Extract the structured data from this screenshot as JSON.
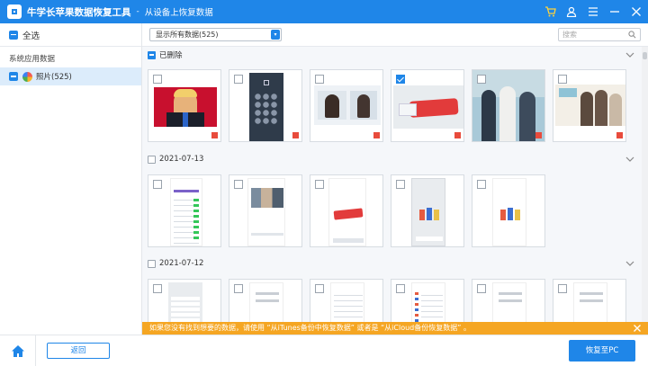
{
  "titlebar": {
    "app_title": "牛学长苹果数据恢复工具",
    "separator": "-",
    "subtitle": "从设备上恢复数据",
    "icons": [
      "cart-icon",
      "user-icon",
      "menu-icon",
      "minimize-icon",
      "close-icon"
    ]
  },
  "sidebar": {
    "select_all_label": "全选",
    "section_label": "系统应用数据",
    "items": [
      {
        "label": "照片(525)",
        "icon": "photos-icon"
      }
    ]
  },
  "header": {
    "filter_value": "显示所有数据(525)",
    "search_placeholder": "搜索"
  },
  "groups": [
    {
      "label": "已删除",
      "tiles": [
        {
          "checked": false,
          "deleted": true,
          "thumb": "photo-person-red-background"
        },
        {
          "checked": false,
          "deleted": true,
          "thumb": "screenshot-lock-screen-keypad"
        },
        {
          "checked": false,
          "deleted": true,
          "thumb": "photo-drama-stills"
        },
        {
          "checked": true,
          "deleted": true,
          "thumb": "photo-red-phone"
        },
        {
          "checked": false,
          "deleted": true,
          "thumb": "photo-group-outdoor"
        },
        {
          "checked": false,
          "deleted": true,
          "thumb": "photo-drama-poster"
        }
      ]
    },
    {
      "label": "2021-07-13",
      "tiles": [
        {
          "checked": false,
          "deleted": false,
          "thumb": "screenshot-settings-list"
        },
        {
          "checked": false,
          "deleted": false,
          "thumb": "screenshot-photo-album"
        },
        {
          "checked": false,
          "deleted": false,
          "thumb": "screenshot-red-phone-page"
        },
        {
          "checked": false,
          "deleted": false,
          "thumb": "screenshot-phones-page"
        },
        {
          "checked": false,
          "deleted": false,
          "thumb": "screenshot-phones-page-light"
        }
      ]
    },
    {
      "label": "2021-07-12",
      "tiles": [
        {
          "checked": false,
          "deleted": false,
          "thumb": "screenshot-settings-gray"
        },
        {
          "checked": false,
          "deleted": false,
          "thumb": "screenshot-settings-white"
        },
        {
          "checked": false,
          "deleted": false,
          "thumb": "screenshot-form-page"
        },
        {
          "checked": false,
          "deleted": false,
          "thumb": "screenshot-settings-color-list"
        },
        {
          "checked": false,
          "deleted": false,
          "thumb": "screenshot-settings-white-2"
        },
        {
          "checked": false,
          "deleted": false,
          "thumb": "screenshot-settings-white-3"
        }
      ]
    }
  ],
  "notice": {
    "text": "如果您没有找到想要的数据，请使用 “从iTunes备份中恢复数据” 或者是 “从iCloud备份恢复数据” 。"
  },
  "footer": {
    "back_label": "返回",
    "recover_label": "恢复至PC"
  },
  "colors": {
    "accent": "#1f86e8",
    "notice": "#f5a623",
    "deleted_badge": "#e84b3c",
    "selected_row": "#dcecfb"
  }
}
